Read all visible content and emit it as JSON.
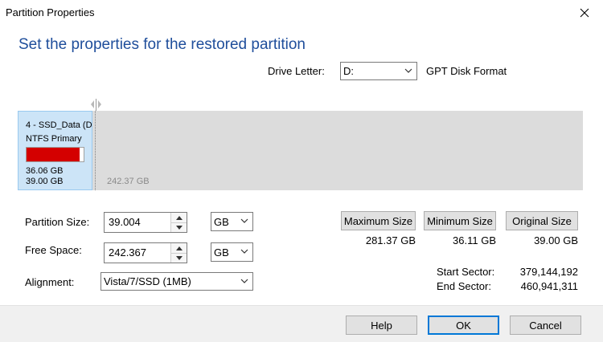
{
  "window": {
    "title": "Partition Properties"
  },
  "heading": "Set the properties for the restored partition",
  "drive": {
    "label": "Drive Letter:",
    "value": "D:",
    "format_text": "GPT Disk Format"
  },
  "disk_map": {
    "partition_name": "4 - SSD_Data (D",
    "partition_type": "NTFS Primary",
    "used_fraction": 0.925,
    "used_size": "36.06 GB",
    "total_size": "39.00 GB",
    "unallocated_size": "242.37 GB"
  },
  "form": {
    "partition_size_label": "Partition Size:",
    "partition_size_value": "39.004",
    "partition_size_unit": "GB",
    "free_space_label": "Free Space:",
    "free_space_value": "242.367",
    "free_space_unit": "GB",
    "alignment_label": "Alignment:",
    "alignment_value": "Vista/7/SSD (1MB)"
  },
  "size_buttons": {
    "maximum": {
      "label": "Maximum Size",
      "value": "281.37 GB"
    },
    "minimum": {
      "label": "Minimum Size",
      "value": "36.11 GB"
    },
    "original": {
      "label": "Original Size",
      "value": "39.00 GB"
    }
  },
  "sectors": {
    "start_label": "Start Sector:",
    "start_value": "379,144,192",
    "end_label": "End Sector:",
    "end_value": "460,941,311"
  },
  "footer": {
    "help": "Help",
    "ok": "OK",
    "cancel": "Cancel"
  },
  "colors": {
    "heading": "#1f4e9b",
    "used_bar": "#d40000",
    "partition_bg": "#cce4f7",
    "ok_border": "#0078d7"
  },
  "icons": {
    "close": "close-icon",
    "dropdown": "chevron-down-icon",
    "spin_up": "spin-up-icon",
    "spin_down": "spin-down-icon",
    "handle": "resize-handle-icon"
  }
}
